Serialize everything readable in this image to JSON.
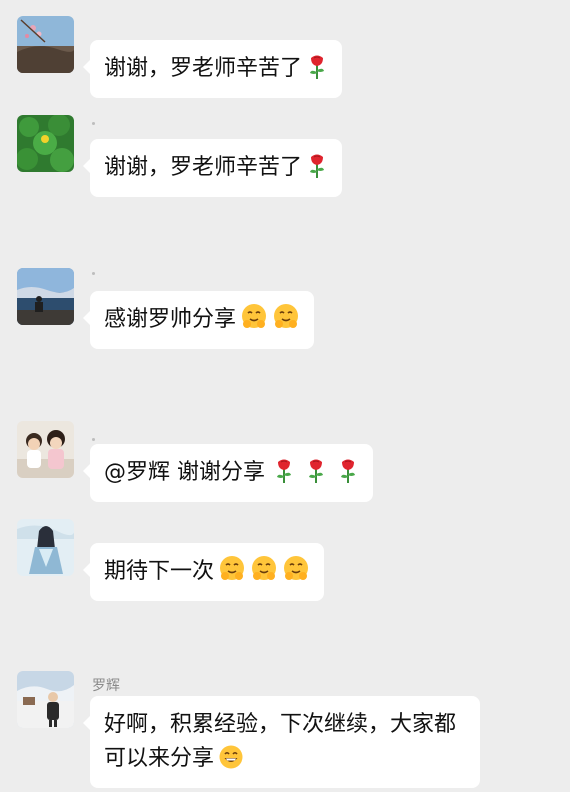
{
  "messages": [
    {
      "text": "谢谢，罗老师辛苦了",
      "emoji": [
        "rose-icon"
      ]
    },
    {
      "text": "谢谢，罗老师辛苦了",
      "emoji": [
        "rose-icon"
      ]
    },
    {
      "text": "感谢罗帅分享",
      "emoji": [
        "hug-face-icon",
        "hug-face-icon"
      ]
    },
    {
      "text": "@罗辉  谢谢分享",
      "emoji": [
        "rose-icon",
        "rose-icon",
        "rose-icon"
      ]
    },
    {
      "text": "期待下一次",
      "emoji": [
        "hug-face-icon",
        "hug-face-icon",
        "hug-face-icon"
      ]
    },
    {
      "sender": "罗辉",
      "text": "好啊，积累经验，下次继续，大家都可以来分享",
      "emoji": [
        "grin-face-icon"
      ]
    }
  ],
  "colors": {
    "background": "#ededed",
    "bubble": "#ffffff",
    "text": "#111111",
    "sender": "#8a8a8a"
  }
}
